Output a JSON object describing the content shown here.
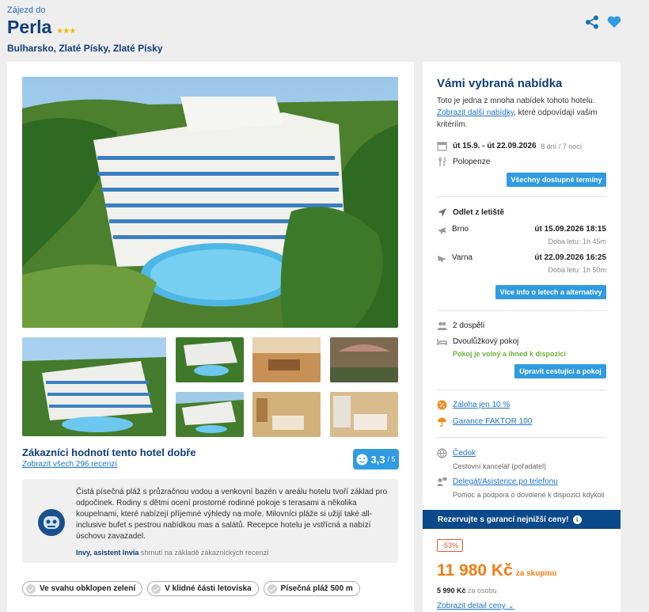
{
  "header": {
    "eyebrow": "Zájezd do",
    "hotel_name": "Perla",
    "stars": "★★★",
    "location": "Bulharsko, Zlaté Písky, Zlaté Písky",
    "icons": [
      "share-icon",
      "heart-icon"
    ]
  },
  "rating": {
    "title": "Zákazníci hodnotí tento hotel dobře",
    "link": "Zobrazit všech 296 recenzí",
    "score": "3,3",
    "scale": "/ 5"
  },
  "review": {
    "text": "Čistá písečná pláž s průzračnou vodou a venkovní bazén v areálu hotelu tvoří základ pro odpočinek. Rodiny s dětmi ocení prostorné rodinné pokoje s terasami a několika koupelnami, které nabízejí příjemné výhledy na moře. Milovníci pláže si užijí také all-inclusive bufet s pestrou nabídkou mas a salátů. Recepce hotelu je vstřícná a nabízí úschovu zavazadel.",
    "author": "Invy, asistent Invia",
    "author_suffix": " shrnutí na základě zákaznických recenzí"
  },
  "chips": [
    "Ve svahu obklopen zelení",
    "V klidné části letoviska",
    "Písečná pláž 500 m"
  ],
  "offer": {
    "title": "Vámi vybraná nabídka",
    "desc_prefix": "Toto je jedna z mnoha nabídek tohoto hotelu.",
    "desc_link": "Zobrazit další nabídky",
    "desc_suffix": ", které odpovídají vašim kritériím.",
    "dates": "út 15.9. - út 22.09.2026",
    "nights": "8 dní / 7 nocí",
    "board": "Polopenze",
    "all_dates_btn": "Všechny dostupné termíny",
    "departure_label": "Odlet z letiště",
    "flights": [
      {
        "city": "Brno",
        "time": "út 15.09.2026 18:15",
        "duration": "Doba letu: 1h 45m"
      },
      {
        "city": "Varna",
        "time": "út 22.09.2026 16:25",
        "duration": "Doba letu: 1h 50m"
      }
    ],
    "flights_btn": "Více info o letech a alternativy",
    "travellers": "2 dospělí",
    "room": "Dvoulůžkový pokoj",
    "room_status": "Pokoj je volný a ihned k dispozici",
    "edit_btn": "Upravit cestující a pokoj",
    "deposit": "Záloha jen 10 %",
    "guarantee": "Garance FAKTOR 100",
    "agency": "Čedok",
    "agency_sub": "Cestovní kancelář (pořadatel)",
    "delegate": "Delegát/Asistence po telefonu",
    "delegate_sub": "Pomoc a podpora o dovolené k dispozici kdykoli",
    "promo": "Rezervujte s garancí nejnižší ceny!",
    "discount": "-53%",
    "price": "11 980 Kč",
    "price_suffix": "za skupinu",
    "per_person_price": "5 990 Kč",
    "per_person_label": "za osobu",
    "detail_link": "Zobrazit detail ceny"
  },
  "colors": {
    "brand": "#0f3f78",
    "accent": "#2f9be0",
    "price": "#f07d14",
    "promo": "#0b4a8a"
  }
}
